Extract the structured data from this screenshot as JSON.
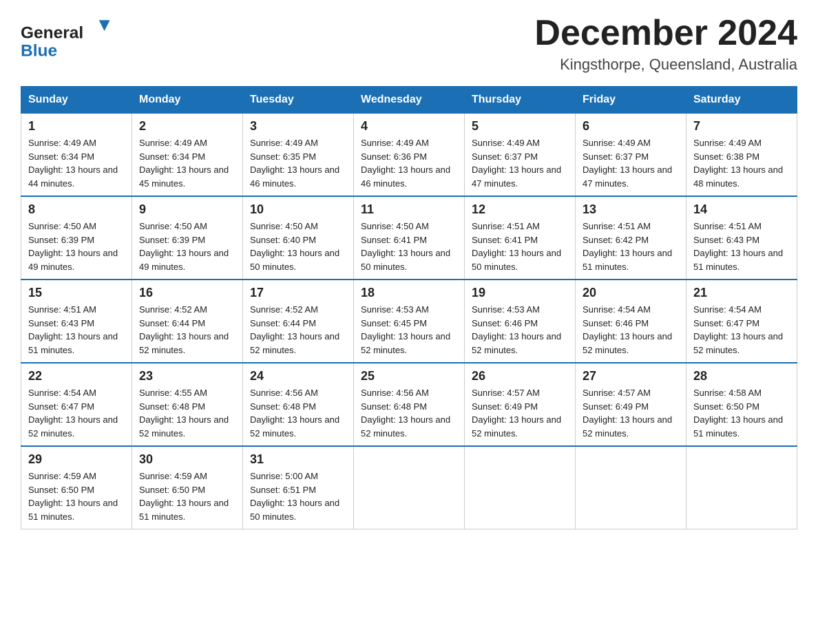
{
  "header": {
    "logo_general": "General",
    "logo_blue": "Blue",
    "month_title": "December 2024",
    "location": "Kingsthorpe, Queensland, Australia"
  },
  "days_of_week": [
    "Sunday",
    "Monday",
    "Tuesday",
    "Wednesday",
    "Thursday",
    "Friday",
    "Saturday"
  ],
  "weeks": [
    [
      {
        "day": "1",
        "sunrise": "4:49 AM",
        "sunset": "6:34 PM",
        "daylight": "13 hours and 44 minutes."
      },
      {
        "day": "2",
        "sunrise": "4:49 AM",
        "sunset": "6:34 PM",
        "daylight": "13 hours and 45 minutes."
      },
      {
        "day": "3",
        "sunrise": "4:49 AM",
        "sunset": "6:35 PM",
        "daylight": "13 hours and 46 minutes."
      },
      {
        "day": "4",
        "sunrise": "4:49 AM",
        "sunset": "6:36 PM",
        "daylight": "13 hours and 46 minutes."
      },
      {
        "day": "5",
        "sunrise": "4:49 AM",
        "sunset": "6:37 PM",
        "daylight": "13 hours and 47 minutes."
      },
      {
        "day": "6",
        "sunrise": "4:49 AM",
        "sunset": "6:37 PM",
        "daylight": "13 hours and 47 minutes."
      },
      {
        "day": "7",
        "sunrise": "4:49 AM",
        "sunset": "6:38 PM",
        "daylight": "13 hours and 48 minutes."
      }
    ],
    [
      {
        "day": "8",
        "sunrise": "4:50 AM",
        "sunset": "6:39 PM",
        "daylight": "13 hours and 49 minutes."
      },
      {
        "day": "9",
        "sunrise": "4:50 AM",
        "sunset": "6:39 PM",
        "daylight": "13 hours and 49 minutes."
      },
      {
        "day": "10",
        "sunrise": "4:50 AM",
        "sunset": "6:40 PM",
        "daylight": "13 hours and 50 minutes."
      },
      {
        "day": "11",
        "sunrise": "4:50 AM",
        "sunset": "6:41 PM",
        "daylight": "13 hours and 50 minutes."
      },
      {
        "day": "12",
        "sunrise": "4:51 AM",
        "sunset": "6:41 PM",
        "daylight": "13 hours and 50 minutes."
      },
      {
        "day": "13",
        "sunrise": "4:51 AM",
        "sunset": "6:42 PM",
        "daylight": "13 hours and 51 minutes."
      },
      {
        "day": "14",
        "sunrise": "4:51 AM",
        "sunset": "6:43 PM",
        "daylight": "13 hours and 51 minutes."
      }
    ],
    [
      {
        "day": "15",
        "sunrise": "4:51 AM",
        "sunset": "6:43 PM",
        "daylight": "13 hours and 51 minutes."
      },
      {
        "day": "16",
        "sunrise": "4:52 AM",
        "sunset": "6:44 PM",
        "daylight": "13 hours and 52 minutes."
      },
      {
        "day": "17",
        "sunrise": "4:52 AM",
        "sunset": "6:44 PM",
        "daylight": "13 hours and 52 minutes."
      },
      {
        "day": "18",
        "sunrise": "4:53 AM",
        "sunset": "6:45 PM",
        "daylight": "13 hours and 52 minutes."
      },
      {
        "day": "19",
        "sunrise": "4:53 AM",
        "sunset": "6:46 PM",
        "daylight": "13 hours and 52 minutes."
      },
      {
        "day": "20",
        "sunrise": "4:54 AM",
        "sunset": "6:46 PM",
        "daylight": "13 hours and 52 minutes."
      },
      {
        "day": "21",
        "sunrise": "4:54 AM",
        "sunset": "6:47 PM",
        "daylight": "13 hours and 52 minutes."
      }
    ],
    [
      {
        "day": "22",
        "sunrise": "4:54 AM",
        "sunset": "6:47 PM",
        "daylight": "13 hours and 52 minutes."
      },
      {
        "day": "23",
        "sunrise": "4:55 AM",
        "sunset": "6:48 PM",
        "daylight": "13 hours and 52 minutes."
      },
      {
        "day": "24",
        "sunrise": "4:56 AM",
        "sunset": "6:48 PM",
        "daylight": "13 hours and 52 minutes."
      },
      {
        "day": "25",
        "sunrise": "4:56 AM",
        "sunset": "6:48 PM",
        "daylight": "13 hours and 52 minutes."
      },
      {
        "day": "26",
        "sunrise": "4:57 AM",
        "sunset": "6:49 PM",
        "daylight": "13 hours and 52 minutes."
      },
      {
        "day": "27",
        "sunrise": "4:57 AM",
        "sunset": "6:49 PM",
        "daylight": "13 hours and 52 minutes."
      },
      {
        "day": "28",
        "sunrise": "4:58 AM",
        "sunset": "6:50 PM",
        "daylight": "13 hours and 51 minutes."
      }
    ],
    [
      {
        "day": "29",
        "sunrise": "4:59 AM",
        "sunset": "6:50 PM",
        "daylight": "13 hours and 51 minutes."
      },
      {
        "day": "30",
        "sunrise": "4:59 AM",
        "sunset": "6:50 PM",
        "daylight": "13 hours and 51 minutes."
      },
      {
        "day": "31",
        "sunrise": "5:00 AM",
        "sunset": "6:51 PM",
        "daylight": "13 hours and 50 minutes."
      },
      null,
      null,
      null,
      null
    ]
  ],
  "labels": {
    "sunrise_prefix": "Sunrise: ",
    "sunset_prefix": "Sunset: ",
    "daylight_prefix": "Daylight: "
  }
}
